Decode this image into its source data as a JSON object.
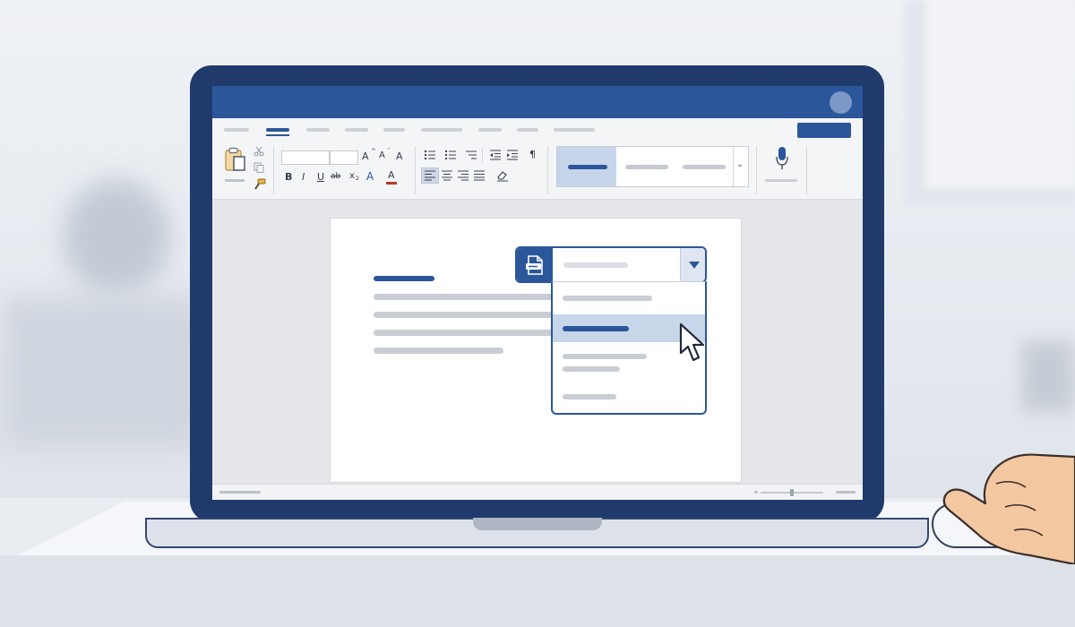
{
  "app": {
    "kind": "word-processor",
    "accent_color": "#2b579a",
    "selection_color": "#c8d6ea"
  },
  "ribbon": {
    "clipboard": {
      "icons": [
        "paste-icon",
        "cut-icon",
        "copy-icon",
        "format-painter-icon"
      ]
    },
    "font": {
      "grow_label": "A",
      "shrink_label": "A",
      "case_label": "A",
      "bold_label": "B",
      "italic_label": "I",
      "underline_label": "U",
      "strike_label": "ab",
      "subscript_label": "x",
      "highlight_label": "A",
      "color_label": "A"
    },
    "paragraph": {
      "show_marks_label": "¶",
      "icons": [
        "bullets-icon",
        "numbering-icon",
        "multilevel-icon",
        "decrease-indent-icon",
        "increase-indent-icon",
        "align-left-icon",
        "align-center-icon",
        "align-right-icon",
        "justify-icon",
        "clear-format-icon"
      ]
    },
    "styles": {
      "selected_index": 0,
      "chevron": "⌄"
    },
    "voice": {
      "icon": "microphone-icon"
    }
  },
  "template_dropdown": {
    "icon": "document-template-icon",
    "arrow_icon": "triangle-down-icon",
    "selected_index": 1,
    "option_count": 4
  }
}
